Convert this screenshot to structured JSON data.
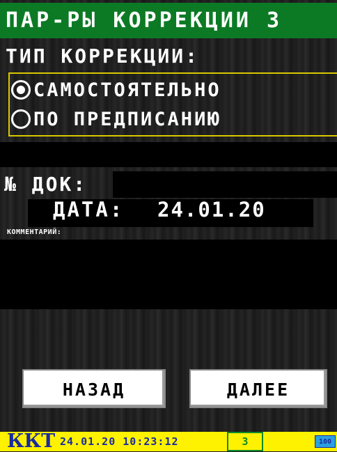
{
  "title": "ПАР-РЫ КОРРЕКЦИИ 3",
  "correction_type_label": "ТИП КОРРЕКЦИИ:",
  "options": [
    {
      "label": "САМОСТОЯТЕЛЬНО",
      "checked": true
    },
    {
      "label": "ПО ПРЕДПИСАНИЮ",
      "checked": false
    }
  ],
  "doc_number_label": "№ ДОК:",
  "doc_number_value": "",
  "date_label": "ДАТА:",
  "date_value": "24.01.20",
  "comment_label": "КОММЕНТАРИЙ:",
  "comment_value": "",
  "buttons": {
    "back": "НАЗАД",
    "next": "ДАЛЕЕ"
  },
  "status": {
    "device": "ККТ",
    "datetime": "24.01.20 10:23:12",
    "counter": "3",
    "battery": "100"
  },
  "colors": {
    "title_bar": "#0c7a24",
    "radio_frame": "#d8c800",
    "status_bar": "#fff200",
    "status_text": "#1a2aa0",
    "counter_border": "#0c8a2a",
    "battery": "#2aa0e0"
  },
  "icons": [
    "radio-checked-icon",
    "radio-unchecked-icon",
    "battery-icon"
  ]
}
